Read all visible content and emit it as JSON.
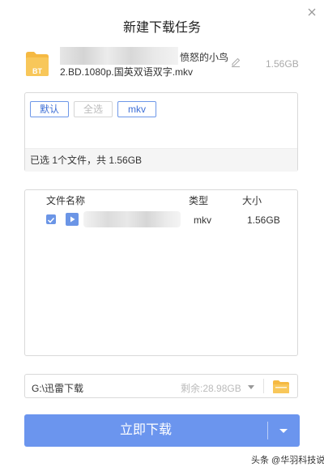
{
  "dialog": {
    "title": "新建下载任务"
  },
  "task": {
    "name_line1": "愤怒的小鸟",
    "name_line2": "2.BD.1080p.国英双语双字.mkv",
    "size": "1.56GB",
    "icon_label": "BT"
  },
  "filters": {
    "buttons": [
      {
        "label": "默认",
        "enabled": true
      },
      {
        "label": "全选",
        "enabled": false
      },
      {
        "label": "mkv",
        "enabled": true
      }
    ],
    "summary": "已选 1个文件，共 1.56GB"
  },
  "file_table": {
    "headers": {
      "name": "文件名称",
      "type": "类型",
      "size": "大小"
    },
    "rows": [
      {
        "checked": true,
        "type": "mkv",
        "size": "1.56GB"
      }
    ]
  },
  "save_path": {
    "path": "G:\\迅雷下载",
    "free_space": "剩余:28.98GB"
  },
  "download": {
    "label": "立即下载"
  },
  "watermark": "头条 @华羽科技说",
  "colors": {
    "accent": "#6b95ee",
    "folder": "#f5b942"
  }
}
